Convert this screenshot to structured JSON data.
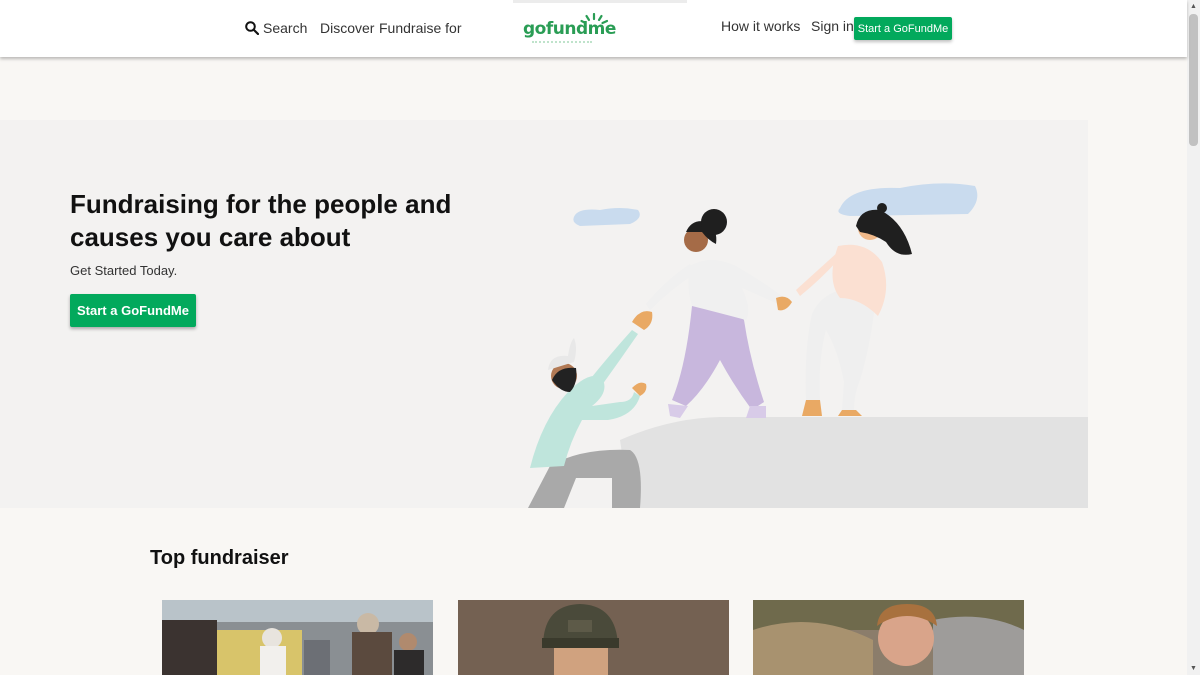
{
  "header": {
    "search_label": "Search",
    "discover_label": "Discover",
    "fundraise_label": "Fundraise for",
    "logo_text": "gofundme",
    "how_it_works_label": "How it works",
    "sign_in_label": "Sign in",
    "start_button_label": "Start a GoFundMe"
  },
  "hero": {
    "title": "Fundraising for the people and causes you care about",
    "subtitle": "Get Started Today.",
    "cta_label": "Start a GoFundMe"
  },
  "top_fundraiser": {
    "heading": "Top fundraiser"
  },
  "colors": {
    "brand_green": "#02a95c",
    "logo_green": "#2a9d55",
    "hero_bg": "#f3f2f1",
    "page_bg": "#f9f7f4"
  },
  "icons": [
    "search-icon",
    "gofundme-logo-icon"
  ]
}
